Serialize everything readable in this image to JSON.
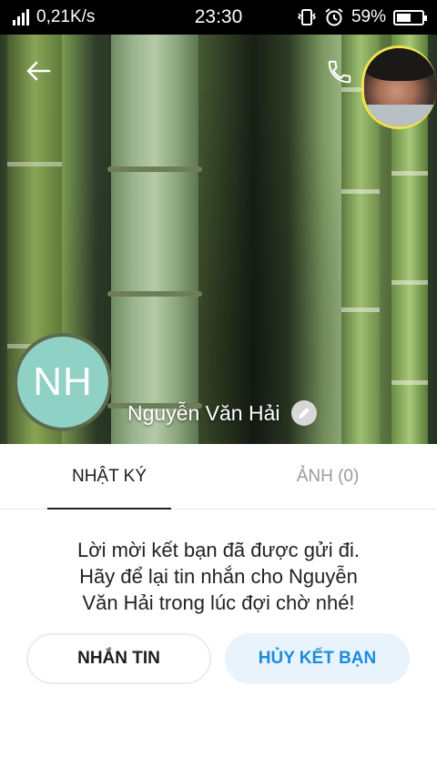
{
  "status_bar": {
    "network_speed": "0,21K/s",
    "time": "23:30",
    "battery_percent": "59%",
    "battery_level": 0.59,
    "icons": [
      "signal-icon",
      "vibrate-icon",
      "alarm-icon",
      "battery-icon"
    ]
  },
  "profile": {
    "initials": "NH",
    "name": "Nguyễn Văn Hải",
    "avatar_color": "#8fd1c4"
  },
  "header": {
    "icons": [
      "back-arrow-icon",
      "phone-icon",
      "pencil-icon"
    ]
  },
  "tabs": [
    {
      "label": "NHẬT KÝ",
      "active": true
    },
    {
      "label": "ẢNH (0)",
      "active": false
    }
  ],
  "main": {
    "message_line1": "Lời mời kết bạn đã được gửi đi.",
    "message_line2": "Hãy để lại tin nhắn cho Nguyễn",
    "message_line3": "Văn Hải trong lúc đợi chờ nhé!"
  },
  "actions": {
    "message_label": "NHẮN TIN",
    "unfriend_label": "HỦY KẾT BẠN",
    "accent_color": "#1a8be0"
  }
}
